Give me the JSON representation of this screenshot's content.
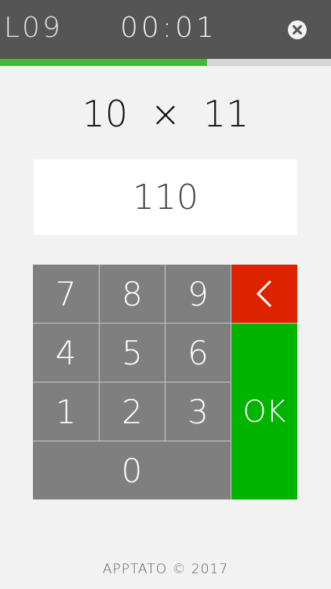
{
  "header": {
    "level": "L09",
    "timer": "00:01",
    "close_icon": "close-circle-icon"
  },
  "progress": {
    "fraction": 0.625,
    "fill_color": "#3cbb3c"
  },
  "problem": {
    "text": "10 × 11"
  },
  "answer": {
    "value": "110"
  },
  "keypad": {
    "keys": [
      "7",
      "8",
      "9",
      "4",
      "5",
      "6",
      "1",
      "2",
      "3",
      "0"
    ],
    "back_icon": "chevron-left-icon",
    "back_color": "#dd2200",
    "ok_label": "OK",
    "ok_color": "#00b400",
    "key_color": "#7f7f7f"
  },
  "footer": {
    "text": "APPTATO © 2017"
  }
}
